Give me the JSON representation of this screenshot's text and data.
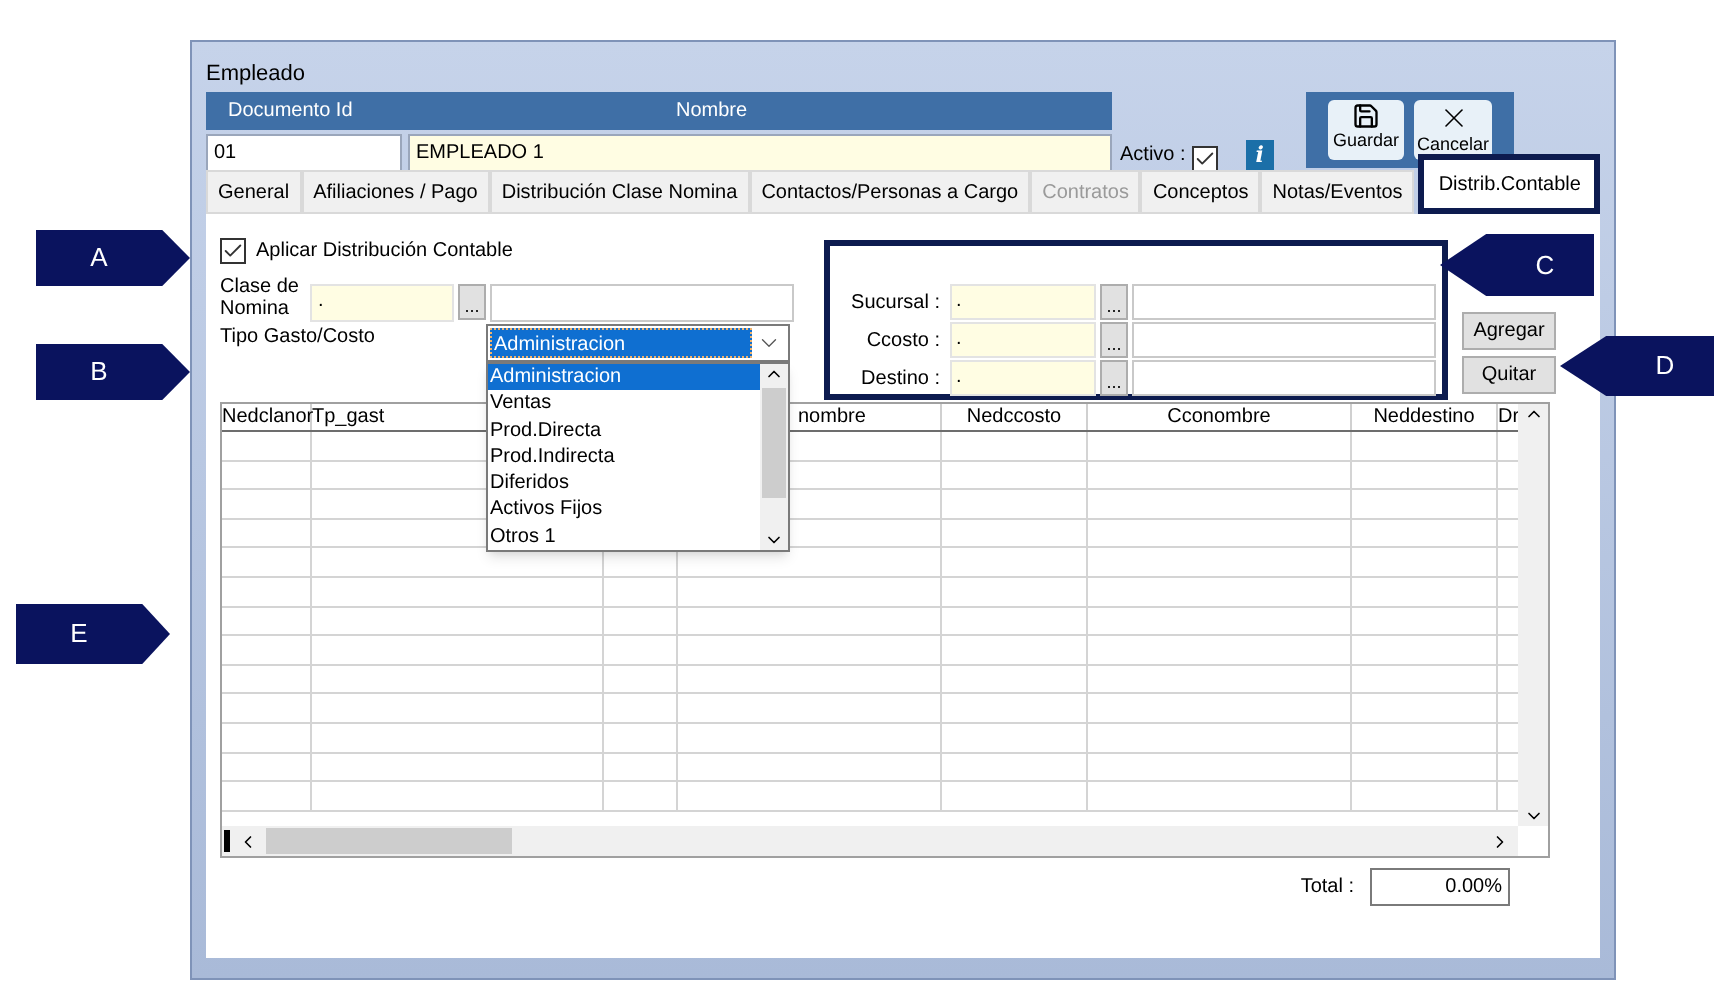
{
  "window": {
    "title": "Empleado"
  },
  "header": {
    "columns": [
      "Documento Id",
      "Nombre"
    ],
    "documento_id": "01",
    "nombre": "EMPLEADO 1",
    "activo_label": "Activo :",
    "activo_checked": true,
    "info": "i"
  },
  "toolbar": [
    {
      "kind": "save",
      "label": "Guardar"
    },
    {
      "kind": "cancel",
      "label": "Cancelar"
    }
  ],
  "tabs": [
    {
      "label": "General",
      "selected": false,
      "disabled": false
    },
    {
      "label": "Afiliaciones / Pago",
      "selected": false,
      "disabled": false
    },
    {
      "label": "Distribución Clase Nomina",
      "selected": false,
      "disabled": false
    },
    {
      "label": "Contactos/Personas a Cargo",
      "selected": false,
      "disabled": false
    },
    {
      "label": "Contratos",
      "selected": false,
      "disabled": true
    },
    {
      "label": "Conceptos",
      "selected": false,
      "disabled": false
    },
    {
      "label": "Notas/Eventos",
      "selected": false,
      "disabled": false
    },
    {
      "label": "Distrib.Contable",
      "selected": true,
      "disabled": false
    }
  ],
  "aplicar": {
    "label": "Aplicar Distribución Contable",
    "checked": true
  },
  "clase_nomina": {
    "label": "Clase de Nomina",
    "value": ".",
    "browse": "..."
  },
  "tipo_gasto": {
    "label": "Tipo Gasto/Costo",
    "value": "Administracion",
    "options": [
      {
        "label": "Administracion",
        "selected": true
      },
      {
        "label": "Ventas",
        "selected": false
      },
      {
        "label": "Prod.Directa",
        "selected": false
      },
      {
        "label": "Prod.Indirecta",
        "selected": false
      },
      {
        "label": "Diferidos",
        "selected": false
      },
      {
        "label": "Activos Fijos",
        "selected": false
      },
      {
        "label": "Otros 1",
        "selected": false
      }
    ]
  },
  "fields": [
    {
      "label": "Sucursal :",
      "value": ".",
      "browse": "..."
    },
    {
      "label": "Ccosto :",
      "value": ".",
      "browse": "..."
    },
    {
      "label": "Destino :",
      "value": ".",
      "browse": "..."
    }
  ],
  "buttons": [
    "Agregar",
    "Quitar"
  ],
  "table": {
    "columns": [
      {
        "label": "Nedclanor"
      },
      {
        "label": "Tp_gast"
      },
      {},
      {
        "label": "nombre"
      },
      {
        "label": "Nedccosto"
      },
      {
        "label": "Cconombre"
      },
      {
        "label": "Neddestino"
      },
      {
        "label": "Dr"
      }
    ]
  },
  "total": {
    "label": "Total :",
    "value": "0.00%"
  },
  "callouts": [
    {
      "label": "A"
    },
    {
      "label": "B"
    },
    {
      "label": "C"
    },
    {
      "label": "D"
    },
    {
      "label": "E"
    }
  ]
}
